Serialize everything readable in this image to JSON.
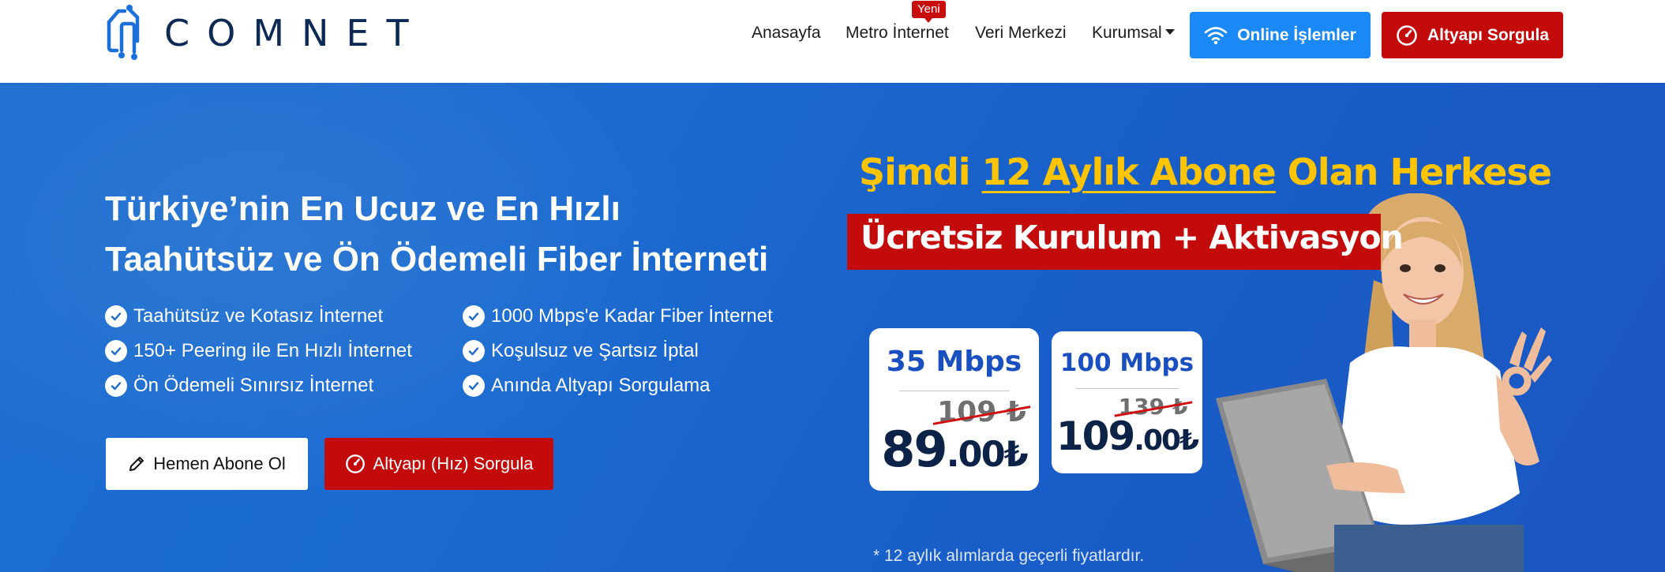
{
  "header": {
    "logo_text": "COMNET",
    "nav": {
      "home": "Anasayfa",
      "metro": "Metro İnternet",
      "metro_badge": "Yeni",
      "veri": "Veri Merkezi",
      "kurumsal": "Kurumsal"
    },
    "buttons": {
      "online": "Online İşlemler",
      "altyapi": "Altyapı Sorgula"
    }
  },
  "hero": {
    "title_line1": "Türkiye’nin En Ucuz ve En Hızlı",
    "title_line2": "Taahütsüz ve Ön Ödemeli Fiber İnterneti",
    "features": [
      "Taahütsüz ve Kotasız İnternet",
      "150+ Peering ile En Hızlı İnternet",
      "Ön Ödemeli Sınırsız İnternet",
      "1000 Mbps'e Kadar Fiber İnternet",
      "Koşulsuz ve Şartsız İptal",
      "Anında Altyapı Sorgulama"
    ],
    "btn_abone": "Hemen Abone Ol",
    "btn_hiz": "Altyapı (Hız) Sorgula"
  },
  "promo": {
    "line1_pre": "Şimdi ",
    "line1_underlined": "12 Aylık Abone",
    "line1_post": " Olan Herkese",
    "line2": "Ücretsiz Kurulum + Aktivasyon",
    "cards": [
      {
        "speed": "35 Mbps",
        "old_price": "109 ₺",
        "price_int": "89",
        "price_dec": ".00₺"
      },
      {
        "speed": "100 Mbps",
        "old_price": "139 ₺",
        "price_int": "109",
        "price_dec": ".00₺"
      }
    ],
    "footnote": "* 12 aylık alımlarda geçerli fiyatlardır."
  },
  "colors": {
    "brand_blue": "#1a88f5",
    "hero_blue": "#1a6ad0",
    "brand_red": "#c30b0b",
    "promo_yellow": "#ffc400",
    "logo_navy": "#0d2a55"
  },
  "icons": {
    "wifi": "wifi-icon",
    "speedometer": "speedometer-icon",
    "check": "check-circle-icon",
    "pencil": "pencil-icon"
  }
}
